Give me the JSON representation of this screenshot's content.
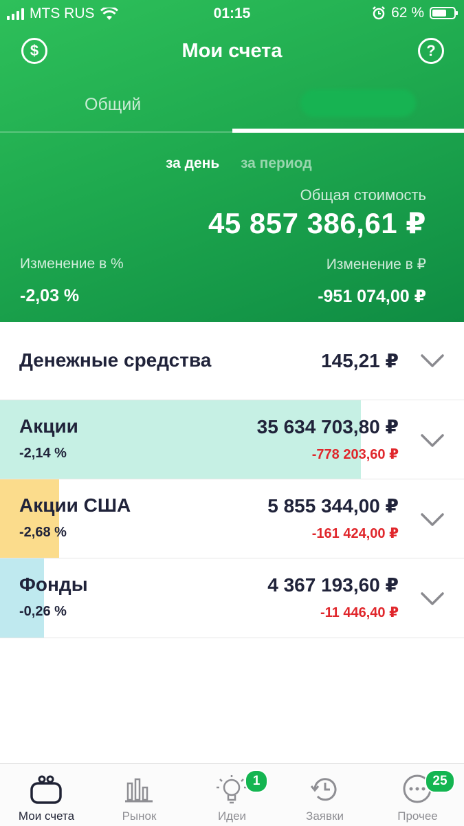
{
  "status_bar": {
    "carrier": "MTS RUS",
    "time": "01:15",
    "battery": "62 %"
  },
  "nav": {
    "title": "Мои счета",
    "help": "?"
  },
  "tabs": [
    {
      "label": "Общий",
      "active": false
    },
    {
      "label": "",
      "active": true
    }
  ],
  "period": {
    "day": "за день",
    "period": "за период",
    "selected": "за день"
  },
  "summary": {
    "total_label": "Общая стоимость",
    "total_value": "45 857 386,61 ₽",
    "change_pct_label": "Изменение в %",
    "change_pct_value": "-2,03 %",
    "change_rub_label": "Изменение в ₽",
    "change_rub_value": "-951 074,00 ₽"
  },
  "cash": {
    "label": "Денежные средства",
    "amount": "145,21 ₽"
  },
  "assets": [
    {
      "name": "Акции",
      "pct": "-2,14 %",
      "amount": "35 634 703,80 ₽",
      "delta": "-778 203,60 ₽",
      "share": 0.777,
      "color": "#c6f0e4"
    },
    {
      "name": "Акции США",
      "pct": "-2,68 %",
      "amount": "5 855 344,00 ₽",
      "delta": "-161 424,00 ₽",
      "share": 0.128,
      "color": "#fbdc8c"
    },
    {
      "name": "Фонды",
      "pct": "-0,26 %",
      "amount": "4 367 193,60 ₽",
      "delta": "-11 446,40 ₽",
      "share": 0.095,
      "color": "#bfe9ef"
    }
  ],
  "tabbar": [
    {
      "label": "Мои счета",
      "icon": "wallet-icon",
      "active": true
    },
    {
      "label": "Рынок",
      "icon": "market-icon",
      "active": false
    },
    {
      "label": "Идеи",
      "icon": "lightbulb-icon",
      "active": false,
      "badge": "1"
    },
    {
      "label": "Заявки",
      "icon": "history-icon",
      "active": false
    },
    {
      "label": "Прочее",
      "icon": "more-icon",
      "active": false,
      "badge": "25"
    }
  ],
  "colors": {
    "green": "#1faa4f",
    "negative": "#e0262b",
    "text": "#20233a",
    "inactive": "#8e8e93"
  }
}
